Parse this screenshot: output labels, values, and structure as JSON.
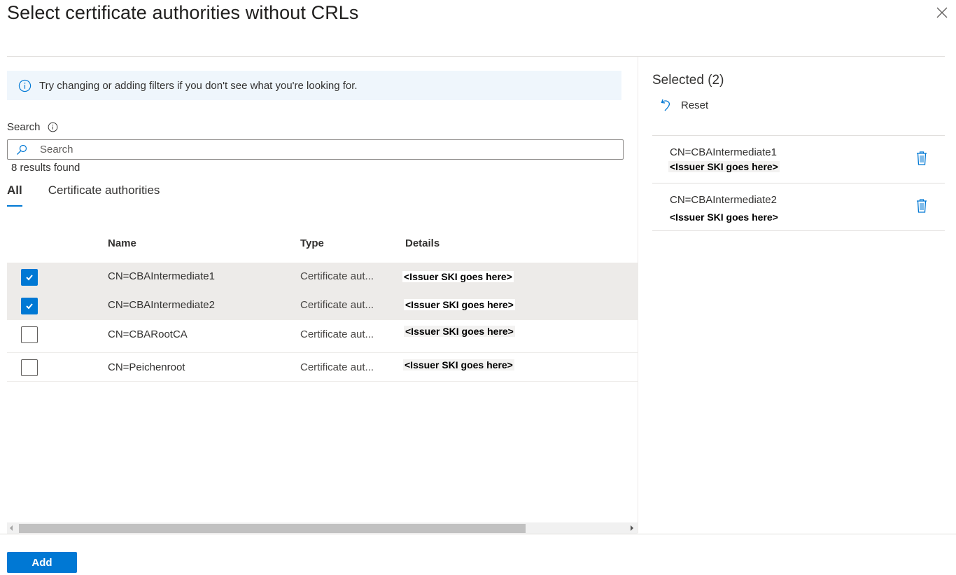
{
  "dialog": {
    "title": "Select certificate authorities without CRLs",
    "close_icon": "close-icon"
  },
  "info_bar": {
    "icon": "info-icon",
    "message": "Try changing or adding filters if you don't see what you're looking for."
  },
  "search": {
    "label": "Search",
    "label_icon": "info-icon",
    "placeholder": "Search",
    "value": "",
    "results_text": "8 results found"
  },
  "tabs": [
    {
      "label": "All",
      "active": true
    },
    {
      "label": "Certificate authorities",
      "active": false
    }
  ],
  "table": {
    "columns": [
      "Name",
      "Type",
      "Details"
    ],
    "rows": [
      {
        "name": "CN=CBAIntermediate1",
        "type": "Certificate aut...",
        "details": "<Issuer SKI goes here>",
        "checked": true
      },
      {
        "name": "CN=CBAIntermediate2",
        "type": "Certificate aut...",
        "details": "<Issuer SKI goes here>",
        "checked": true
      },
      {
        "name": "CN=CBARootCA",
        "type": "Certificate aut...",
        "details": "<Issuer SKI goes here>",
        "checked": false
      },
      {
        "name": "CN=Peichenroot",
        "type": "Certificate aut...",
        "details": "<Issuer SKI goes here>",
        "checked": false
      }
    ]
  },
  "selected_panel": {
    "title": "Selected (2)",
    "reset_label": "Reset",
    "items": [
      {
        "name": "CN=CBAIntermediate1",
        "details": "<Issuer SKI goes here>"
      },
      {
        "name": "CN=CBAIntermediate2",
        "details": "<Issuer SKI goes here>"
      }
    ]
  },
  "footer": {
    "add_label": "Add"
  },
  "colors": {
    "accent": "#0078d4",
    "info_bg": "#eff6fc",
    "selected_row_bg": "#edebe9"
  }
}
